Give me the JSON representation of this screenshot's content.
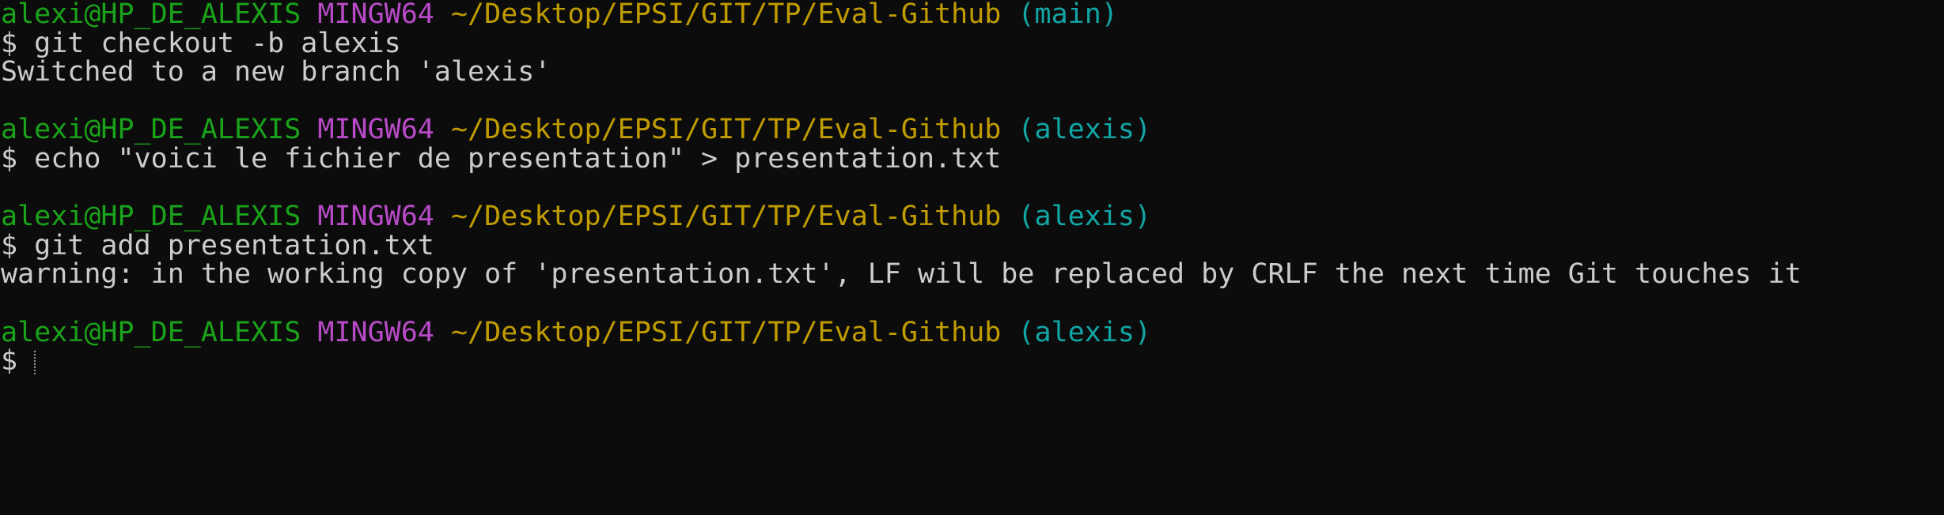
{
  "colors": {
    "background": "#0c0c0c",
    "text": "#cccccc",
    "user": "#1aa31a",
    "system": "#b94bc8",
    "path": "#c19c00",
    "branch": "#12a5a5"
  },
  "terminal": {
    "blocks": [
      {
        "user": "alexi@HP_DE_ALEXIS",
        "system": "MINGW64",
        "path": "~/Desktop/EPSI/GIT/TP/Eval-Github",
        "branch": "(main)",
        "command": "$ git checkout -b alexis",
        "output": "Switched to a new branch 'alexis'"
      },
      {
        "user": "alexi@HP_DE_ALEXIS",
        "system": "MINGW64",
        "path": "~/Desktop/EPSI/GIT/TP/Eval-Github",
        "branch": "(alexis)",
        "command": "$ echo \"voici le fichier de presentation\" > presentation.txt"
      },
      {
        "user": "alexi@HP_DE_ALEXIS",
        "system": "MINGW64",
        "path": "~/Desktop/EPSI/GIT/TP/Eval-Github",
        "branch": "(alexis)",
        "command": "$ git add presentation.txt",
        "output": "warning: in the working copy of 'presentation.txt', LF will be replaced by CRLF the next time Git touches it"
      },
      {
        "user": "alexi@HP_DE_ALEXIS",
        "system": "MINGW64",
        "path": "~/Desktop/EPSI/GIT/TP/Eval-Github",
        "branch": "(alexis)",
        "command": "$ "
      }
    ]
  }
}
